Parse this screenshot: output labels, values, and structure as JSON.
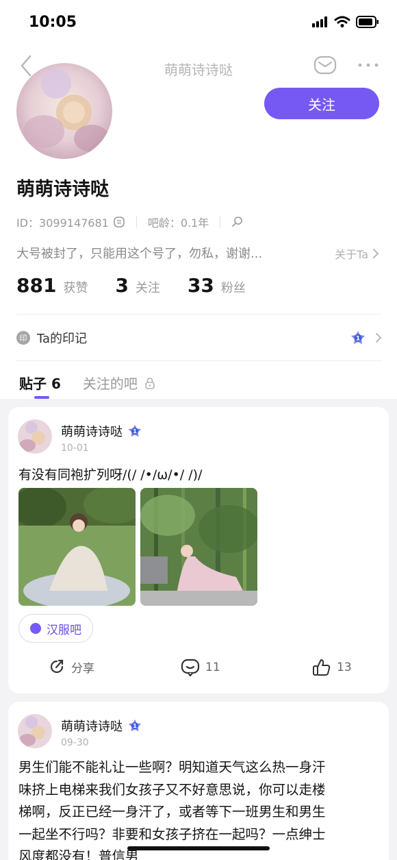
{
  "status": {
    "time": "10:05"
  },
  "nav": {
    "title": "萌萌诗诗哒",
    "back_icon": "chevron-left-icon",
    "mail_icon": "mail-icon",
    "more_icon": "more-icon"
  },
  "profile": {
    "name": "萌萌诗诗哒",
    "follow_label": "关注",
    "id_text": "ID：3099147681",
    "age_text": "吧龄：0.1年",
    "bio": "大号被封了，只能用这个号了，勿私，谢谢...",
    "about_label": "关于Ta",
    "stats": [
      {
        "num": "881",
        "label": "获赞"
      },
      {
        "num": "3",
        "label": "关注"
      },
      {
        "num": "33",
        "label": "粉丝"
      }
    ],
    "imprint_badge": "印",
    "imprint_label": "Ta的印记",
    "level_badge": "1"
  },
  "tabs": {
    "posts": "贴子 6",
    "followed_bars": "关注的吧"
  },
  "posts": [
    {
      "author": "萌萌诗诗哒",
      "date": "10-01",
      "text": "有没有同袍扩列呀/(/ /•/ω/•/ /)/",
      "bar": "汉服吧",
      "share_label": "分享",
      "comments": "11",
      "likes": "13"
    },
    {
      "author": "萌萌诗诗哒",
      "date": "09-30",
      "lines": [
        "男生们能不能礼让一些啊？明知道天气这么热一身汗",
        "味挤上电梯来我们女孩子又不好意思说，你可以走楼",
        "梯啊，反正已经一身汗了，或者等下一班男生和男生",
        "一起坐不行吗？非要和女孩子挤在一起吗？一点绅士",
        "风度都没有！普信男"
      ]
    }
  ],
  "colors": {
    "accent": "#7559f2",
    "feed_bg": "#f3f3f5"
  }
}
